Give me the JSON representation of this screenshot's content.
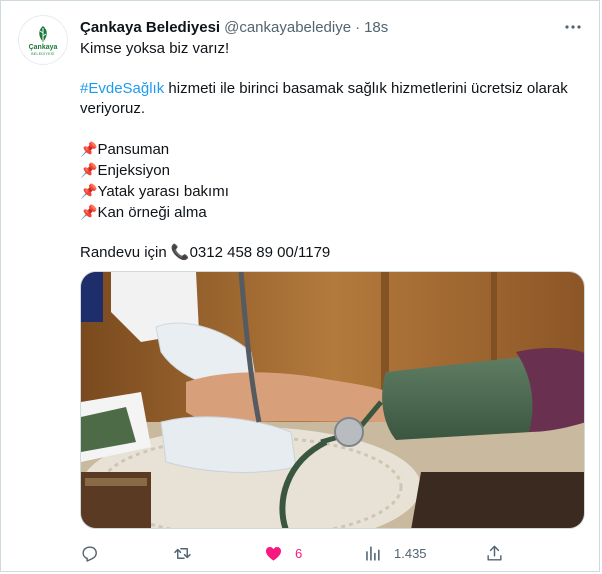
{
  "tweet": {
    "display_name": "Çankaya Belediyesi",
    "handle": "@cankayabelediye",
    "separator": "·",
    "time": "18s",
    "avatar": {
      "logo_text": "Çankaya",
      "logo_sub": "BELEDİYESİ",
      "brand_color": "#1a7a3a"
    },
    "lines": {
      "intro": "Kimse yoksa biz varız!",
      "hashtag": "#EvdeSağlık",
      "service": " hizmeti ile birinci basamak sağlık hizmetlerini ücretsiz olarak veriyoruz.",
      "pin_icon": "📌",
      "items": [
        "Pansuman",
        "Enjeksiyon",
        "Yatak yarası bakımı",
        "Kan örneği alma"
      ],
      "appointment_prefix": "Randevu için ",
      "phone_icon": "📞",
      "phone": "0312 458 89 00/1179"
    },
    "actions": {
      "reply_icon": "reply-icon",
      "retweet_icon": "retweet-icon",
      "like_icon": "heart-icon",
      "like_count": "6",
      "views_icon": "views-icon",
      "views_count": "1.435",
      "share_icon": "share-icon"
    },
    "colors": {
      "link": "#1d9bf0",
      "like": "#f91880",
      "muted": "#536471"
    }
  }
}
